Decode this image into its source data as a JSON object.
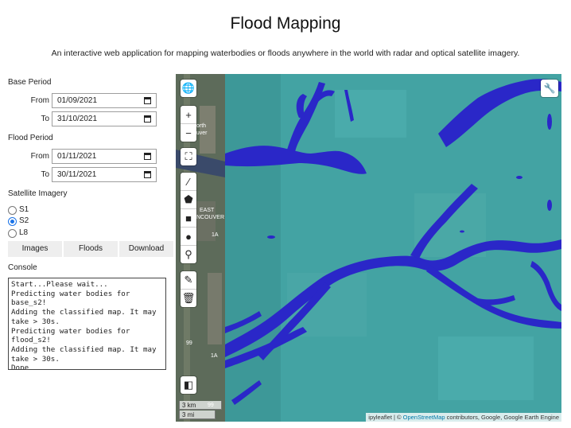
{
  "header": {
    "title": "Flood Mapping",
    "subtitle": "An interactive web application for mapping waterbodies or floods anywhere in the world with radar and optical satellite imagery."
  },
  "base_period": {
    "heading": "Base Period",
    "from_label": "From",
    "from_value": "01/09/2021",
    "to_label": "To",
    "to_value": "31/10/2021"
  },
  "flood_period": {
    "heading": "Flood Period",
    "from_label": "From",
    "from_value": "01/11/2021",
    "to_label": "To",
    "to_value": "30/11/2021"
  },
  "imagery": {
    "heading": "Satellite Imagery",
    "options": [
      "S1",
      "S2",
      "L8"
    ],
    "selected": "S2"
  },
  "buttons": {
    "images": "Images",
    "floods": "Floods",
    "download": "Download"
  },
  "console": {
    "heading": "Console",
    "text": "Start...Please wait...\nPredicting water bodies for base_s2!\nAdding the classified map. It may take > 30s.\nPredicting water bodies for flood_s2!\nAdding the classified map. It may take > 30s.\nDone"
  },
  "map": {
    "scale_km": "3 km",
    "scale_mi": "3 mi",
    "attribution_prefix": "ipyleaflet | © ",
    "attribution_link": "OpenStreetMap",
    "attribution_suffix": " contributors, Google, Google Earth Engine",
    "basemap_labels": [
      "orth",
      "ouver",
      "EAST",
      "NCOUVER",
      "1A",
      "99",
      "99",
      "1A"
    ],
    "icons": {
      "layers": "globe-icon",
      "zoom_in": "plus-icon",
      "zoom_out": "minus-icon",
      "fullscreen": "fullscreen-icon",
      "polyline": "polyline-icon",
      "polygon": "polygon-icon",
      "rectangle": "rectangle-icon",
      "circle": "circle-icon",
      "marker": "marker-icon",
      "edit": "edit-icon",
      "delete": "trash-icon",
      "toolbar": "wrench-icon",
      "split": "split-map-icon"
    },
    "colors": {
      "water": "#2a27c8",
      "land_overlay": "#43a3a3",
      "basemap": "#5a6a5a"
    }
  }
}
